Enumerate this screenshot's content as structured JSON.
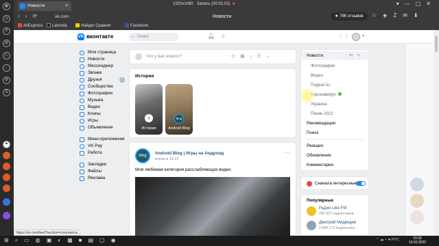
{
  "browser": {
    "tab_title": "Новости",
    "tab_close": "✕",
    "url": "vk.com",
    "page_title": "Новости",
    "recording": {
      "resolution": "1920x1080",
      "label": "Запись (00:01:02)"
    },
    "reviews_badge": "78К отзывов",
    "bookmarks": [
      "AliExpress",
      "Lamoda",
      "Найди! Сравни!",
      "Facebook"
    ],
    "status_url": "https://vk.com/feed?section=coronavirus"
  },
  "vk": {
    "brand": "вконтакте",
    "search_placeholder": "Поиск",
    "left_nav": {
      "group1": [
        "Моя страница",
        "Новости",
        "Мессенджер",
        "Звонки",
        "Друзья",
        "Сообщества",
        "Фотографии",
        "Музыка",
        "Видео",
        "Клипы",
        "Игры",
        "Объявления"
      ],
      "friends_count": "1",
      "group2": [
        "Мини-приложения",
        "VK Pay",
        "Работа"
      ],
      "group3": [
        "Закладки",
        "Файлы",
        "Реклама"
      ]
    },
    "composer_placeholder": "Что у вас нового?",
    "stories": {
      "title": "Истории",
      "items": [
        {
          "label": "История"
        },
        {
          "label": "Android Blog"
        }
      ]
    },
    "post": {
      "author": "Android Blog | Игры на Андроид",
      "time": "вчера в 16:22",
      "text": "Моя любимая категория расслабляющих видео",
      "avatar_text": "blog"
    },
    "right_nav": {
      "news": "Новости",
      "news_subs": [
        "Фотографии",
        "Видео",
        "Подкасты",
        "Коронавирус",
        "Украина",
        "Пекин 2022"
      ],
      "others": [
        "Рекомендации",
        "Поиск"
      ],
      "others2": [
        "Реакции",
        "Обновления",
        "Комментарии"
      ]
    },
    "interesting": "Сначала интересные",
    "popular": {
      "title": "Популярные",
      "items": [
        {
          "name": "Радио Like FM",
          "subs": "285 927 подписчиков"
        },
        {
          "name": "Дмитрий Медведев",
          "subs": "2 868 172 подписчика"
        }
      ]
    }
  },
  "taskbar": {
    "lang": "РУС",
    "time": "10:32",
    "date": "10.02.2022"
  },
  "colors": {
    "vk_blue": "#0077ff",
    "link": "#2a5885",
    "toggle": "#2688eb"
  }
}
